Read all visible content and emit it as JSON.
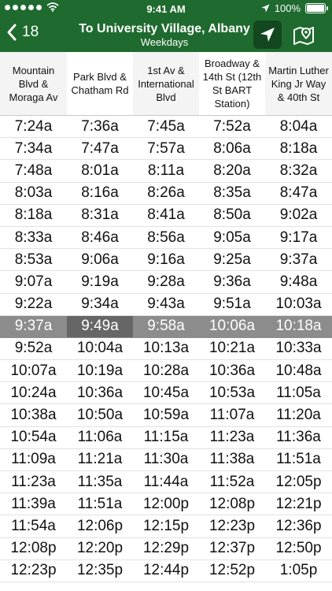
{
  "status_bar": {
    "time": "9:41 AM",
    "battery": "100%",
    "battery_level": 1.0,
    "icons": [
      "signal-dots-icon",
      "wifi-icon",
      "location-arrow-icon",
      "battery-icon"
    ]
  },
  "nav": {
    "back_label": "18",
    "title": "To University Village, Albany",
    "subtitle": "Weekdays",
    "icons": [
      "chevron-left-icon",
      "navigation-arrow-icon",
      "map-pin-icon"
    ]
  },
  "colors": {
    "brand": "#1f6b2f",
    "brand_dark": "#13471f",
    "highlight_row": "#8c8c8c",
    "highlight_cell": "#666666"
  },
  "stops": [
    "Mountain Blvd & Moraga Av",
    "Park Blvd & Chatham Rd",
    "1st Av & International Blvd",
    "Broadway & 14th St (12th St BART Station)",
    "Martin Luther King Jr Way & 40th St"
  ],
  "highlighted_trip": 9,
  "highlighted_stop": 1,
  "trips": [
    [
      "7:24a",
      "7:36a",
      "7:45a",
      "7:52a",
      "8:04a"
    ],
    [
      "7:34a",
      "7:47a",
      "7:57a",
      "8:06a",
      "8:18a"
    ],
    [
      "7:48a",
      "8:01a",
      "8:11a",
      "8:20a",
      "8:32a"
    ],
    [
      "8:03a",
      "8:16a",
      "8:26a",
      "8:35a",
      "8:47a"
    ],
    [
      "8:18a",
      "8:31a",
      "8:41a",
      "8:50a",
      "9:02a"
    ],
    [
      "8:33a",
      "8:46a",
      "8:56a",
      "9:05a",
      "9:17a"
    ],
    [
      "8:53a",
      "9:06a",
      "9:16a",
      "9:25a",
      "9:37a"
    ],
    [
      "9:07a",
      "9:19a",
      "9:28a",
      "9:36a",
      "9:48a"
    ],
    [
      "9:22a",
      "9:34a",
      "9:43a",
      "9:51a",
      "10:03a"
    ],
    [
      "9:37a",
      "9:49a",
      "9:58a",
      "10:06a",
      "10:18a"
    ],
    [
      "9:52a",
      "10:04a",
      "10:13a",
      "10:21a",
      "10:33a"
    ],
    [
      "10:07a",
      "10:19a",
      "10:28a",
      "10:36a",
      "10:48a"
    ],
    [
      "10:24a",
      "10:36a",
      "10:45a",
      "10:53a",
      "11:05a"
    ],
    [
      "10:38a",
      "10:50a",
      "10:59a",
      "11:07a",
      "11:20a"
    ],
    [
      "10:54a",
      "11:06a",
      "11:15a",
      "11:23a",
      "11:36a"
    ],
    [
      "11:09a",
      "11:21a",
      "11:30a",
      "11:38a",
      "11:51a"
    ],
    [
      "11:23a",
      "11:35a",
      "11:44a",
      "11:52a",
      "12:05p"
    ],
    [
      "11:39a",
      "11:51a",
      "12:00p",
      "12:08p",
      "12:21p"
    ],
    [
      "11:54a",
      "12:06p",
      "12:15p",
      "12:23p",
      "12:36p"
    ],
    [
      "12:08p",
      "12:20p",
      "12:29p",
      "12:37p",
      "12:50p"
    ],
    [
      "12:23p",
      "12:35p",
      "12:44p",
      "12:52p",
      "1:05p"
    ]
  ]
}
